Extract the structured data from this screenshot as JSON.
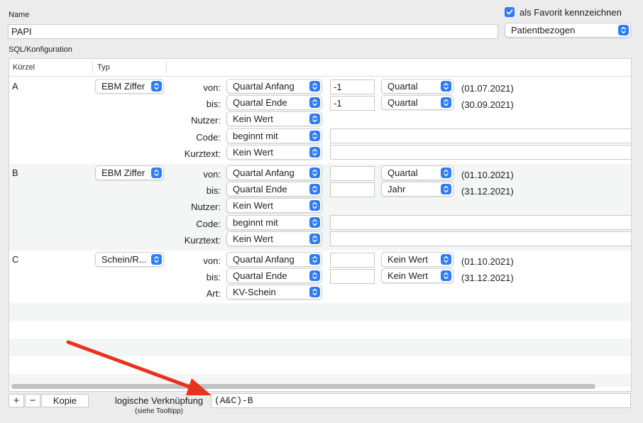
{
  "header": {
    "name_label": "Name",
    "name_value": "PAPI",
    "favorite_label": "als Favorit kennzeichnen",
    "scope_select": "Patientbezogen",
    "sql_label": "SQL/Konfiguration"
  },
  "table": {
    "col_kuerzel": "Kürzel",
    "col_typ": "Typ",
    "rows": [
      {
        "kuerzel": "A",
        "typ": "EBM Ziffer",
        "fields": {
          "von_label": "von:",
          "von_select": "Quartal Anfang",
          "von_offset": "-1",
          "von_unit": "Quartal",
          "von_date": "(01.07.2021)",
          "bis_label": "bis:",
          "bis_select": "Quartal Ende",
          "bis_offset": "-1",
          "bis_unit": "Quartal",
          "bis_date": "(30.09.2021)",
          "nutzer_label": "Nutzer:",
          "nutzer_select": "Kein Wert",
          "code_label": "Code:",
          "code_select": "beginnt mit",
          "code_value": "",
          "kurztext_label": "Kurztext:",
          "kurztext_select": "Kein Wert",
          "kurztext_value": ""
        }
      },
      {
        "kuerzel": "B",
        "typ": "EBM Ziffer",
        "fields": {
          "von_label": "von:",
          "von_select": "Quartal Anfang",
          "von_offset": "",
          "von_unit": "Quartal",
          "von_date": "(01.10.2021)",
          "bis_label": "bis:",
          "bis_select": "Quartal Ende",
          "bis_offset": "",
          "bis_unit": "Jahr",
          "bis_date": "(31.12.2021)",
          "nutzer_label": "Nutzer:",
          "nutzer_select": "Kein Wert",
          "code_label": "Code:",
          "code_select": "beginnt mit",
          "code_value": "",
          "kurztext_label": "Kurztext:",
          "kurztext_select": "Kein Wert",
          "kurztext_value": ""
        }
      },
      {
        "kuerzel": "C",
        "typ": "Schein/R...",
        "fields": {
          "von_label": "von:",
          "von_select": "Quartal Anfang",
          "von_offset": "",
          "von_unit": "Kein Wert",
          "von_date": "(01.10.2021)",
          "bis_label": "bis:",
          "bis_select": "Quartal Ende",
          "bis_offset": "",
          "bis_unit": "Kein Wert",
          "bis_date": "(31.12.2021)",
          "art_label": "Art:",
          "art_select": "KV-Schein"
        }
      }
    ]
  },
  "footer": {
    "add": "+",
    "remove": "−",
    "copy": "Kopie",
    "logic_label": "logische Verknüpfung",
    "logic_hint": "(siehe Tooltipp)",
    "logic_value": "(A&C)-B"
  },
  "colors": {
    "accent": "#2e7cf6",
    "arrow": "#e8321e"
  }
}
